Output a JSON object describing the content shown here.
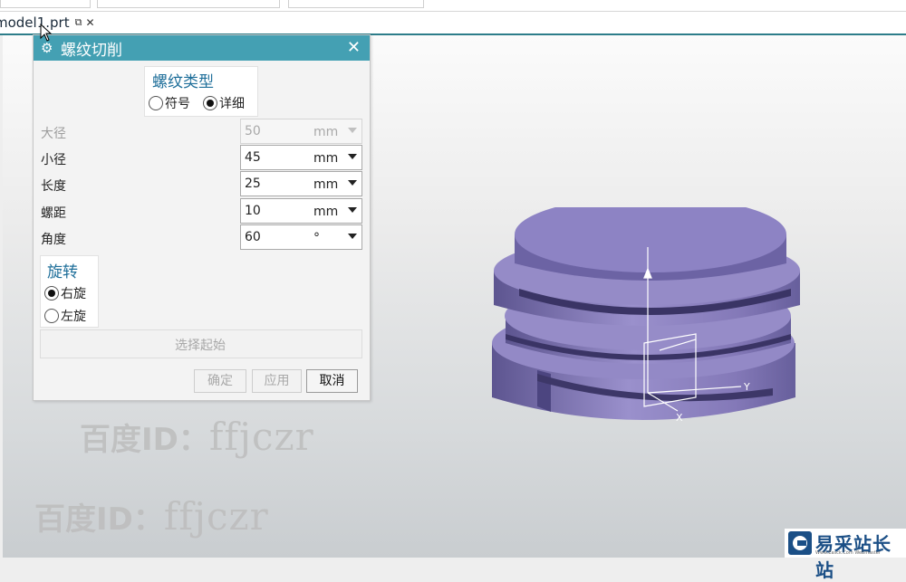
{
  "tab": {
    "label": "model1.prt",
    "pin_icon": "pin-icon",
    "close_icon": "close-icon"
  },
  "dialog": {
    "title": "螺纹切削",
    "thread_type": {
      "title": "螺纹类型",
      "opt_symbolic": "符号",
      "opt_detailed": "详细",
      "selected": "detailed"
    },
    "fields": [
      {
        "label": "大径",
        "value": "50",
        "unit": "mm",
        "enabled": false
      },
      {
        "label": "小径",
        "value": "45",
        "unit": "mm",
        "enabled": true
      },
      {
        "label": "长度",
        "value": "25",
        "unit": "mm",
        "enabled": true
      },
      {
        "label": "螺距",
        "value": "10",
        "unit": "mm",
        "enabled": true
      },
      {
        "label": "角度",
        "value": "60",
        "unit": "°",
        "enabled": true
      }
    ],
    "rotation": {
      "title": "旋转",
      "opt_right": "右旋",
      "opt_left": "左旋",
      "selected": "right"
    },
    "select_start": "选择起始",
    "buttons": {
      "ok": "确定",
      "apply": "应用",
      "cancel": "取消"
    }
  },
  "axis_labels": {
    "y": "Y",
    "x": "X"
  },
  "watermark": {
    "b": "百度ID：",
    "l": "ffjczr"
  },
  "logo": {
    "text": "易采站长站",
    "sub": "Www.Easck.Com Webmaster"
  },
  "colors": {
    "accent": "#44a0b3",
    "model_fill": "#8a7fc0",
    "brand": "#1b4f86"
  }
}
